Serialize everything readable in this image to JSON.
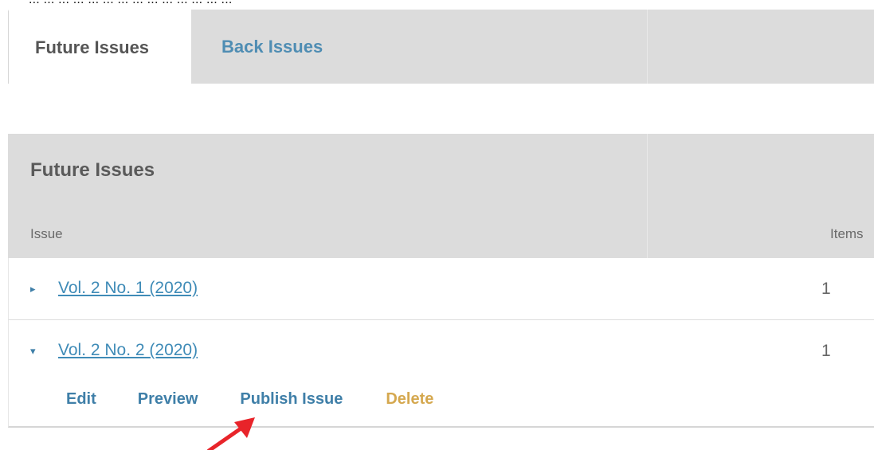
{
  "caption": "... ... ... ... ... ... ... ... ... ... ... ... ... ...",
  "tabs": [
    {
      "label": "Future Issues",
      "active": true
    },
    {
      "label": "Back Issues",
      "active": false
    }
  ],
  "panel": {
    "title": "Future Issues",
    "columns": {
      "issue": "Issue",
      "items": "Items"
    },
    "rows": [
      {
        "title": "Vol. 2 No. 1 (2020)",
        "items": "1",
        "toggle": "▸",
        "expanded": false
      },
      {
        "title": "Vol. 2 No. 2 (2020)",
        "items": "1",
        "toggle": "▾",
        "expanded": true
      }
    ],
    "actions": {
      "edit": "Edit",
      "preview": "Preview",
      "publish": "Publish Issue",
      "delete": "Delete"
    }
  },
  "colors": {
    "link": "#3f8bb7",
    "delete": "#d5a84f",
    "tab_bar": "#dcdcdc",
    "arrow": "#e8242a"
  },
  "icons": {
    "collapsed": "triangle-right-icon",
    "expanded": "triangle-down-icon",
    "pointer": "red-arrow-icon"
  }
}
